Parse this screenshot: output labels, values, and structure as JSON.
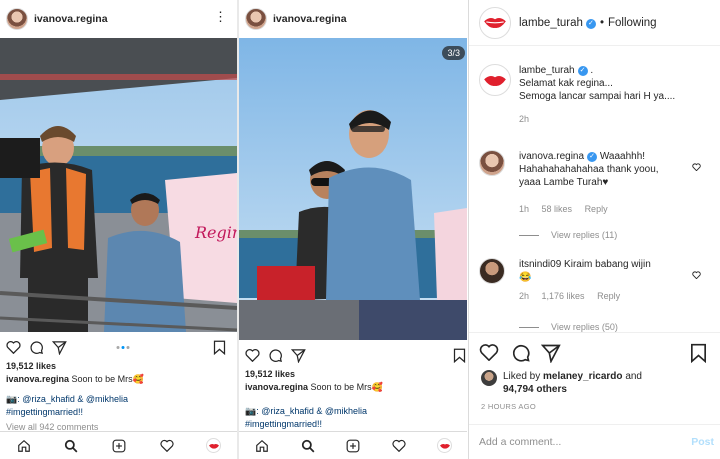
{
  "post1": {
    "username": "ivanova.regina",
    "likes": "19,512 likes",
    "caption_user": "ivanova.regina",
    "caption_text": "Soon to be Mrs🥰",
    "camera_emoji": "📷",
    "credits": ": @riza_khafid & @mikhelia",
    "hashtag": "#imgettingmarried!!",
    "view_all": "View all 942 comments",
    "banner_text": "Regina V..."
  },
  "post2": {
    "username": "ivanova.regina",
    "counter": "3/3",
    "likes": "19,512 likes",
    "caption_user": "ivanova.regina",
    "caption_text": "Soon to be Mrs🥰",
    "camera_emoji": "📷",
    "credits": ": @riza_khafid & @mikhelia",
    "hashtag": "#imgettingmarried!!"
  },
  "panel3": {
    "header": {
      "username": "lambe_turah",
      "verified": "✓",
      "separator": "•",
      "following": "Following"
    },
    "caption": {
      "username": "lambe_turah",
      "verified": "✓",
      "dot": ".",
      "line1": "Selamat kak regina...",
      "line2": "Semoga lancar sampai hari H ya....",
      "time": "2h"
    },
    "comments": [
      {
        "username": "ivanova.regina",
        "verified": "✓",
        "line1": "Waaahhh!",
        "line2": "Hahahahahahahaa thank yoou,",
        "line3": "yaaa Lambe Turah♥",
        "time": "1h",
        "likes": "58 likes",
        "reply": "Reply",
        "view_replies": "View replies (11)"
      },
      {
        "username": "itsnindi09",
        "text": "Kiraim babang wijin",
        "emoji": "😂",
        "time": "2h",
        "likes": "1,176 likes",
        "reply": "Reply",
        "view_replies": "View replies (50)"
      }
    ],
    "liked_by_prefix": "Liked by",
    "liked_by_user": "melaney_ricardo",
    "liked_by_and": "and",
    "liked_by_count": "94,794 others",
    "ago": "2 HOURS AGO",
    "add_comment_placeholder": "Add a comment...",
    "post_label": "Post"
  },
  "colors": {
    "verified": "#3897f0",
    "accent_blue": "#0095f6",
    "brand_red": "#e0202d",
    "sky": "#7fb6e6",
    "sea": "#2f6f9b"
  },
  "icons": [
    "heart-icon",
    "comment-icon",
    "share-icon",
    "bookmark-icon",
    "home-icon",
    "search-icon",
    "add-icon",
    "more-icon"
  ]
}
